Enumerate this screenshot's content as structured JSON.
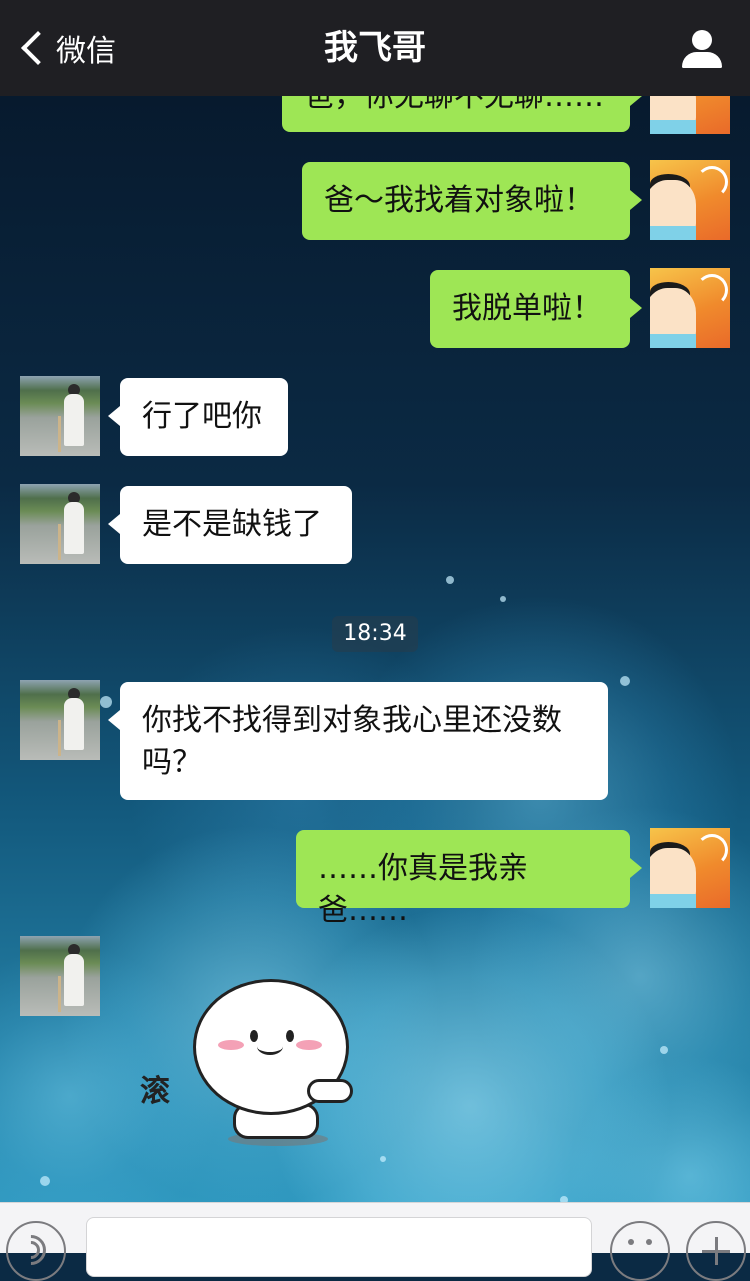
{
  "header": {
    "back_label": "微信",
    "title": "我飞哥"
  },
  "messages": [
    {
      "from": "me",
      "text": "爸，你无聊不无聊……"
    },
    {
      "from": "me",
      "text": "爸～我找着对象啦！"
    },
    {
      "from": "me",
      "text": "我脱单啦！"
    },
    {
      "from": "them",
      "text": "行了吧你"
    },
    {
      "from": "them",
      "text": "是不是缺钱了"
    },
    {
      "from": "them",
      "text": "你找不找得到对象我心里还没数吗？"
    },
    {
      "from": "me",
      "text": "……你真是我亲爸……"
    }
  ],
  "timestamp": "18:34",
  "sticker": {
    "text": "滚"
  },
  "colors": {
    "nav_bg": "#1f1f23",
    "my_bubble": "#9ee655",
    "their_bubble": "#ffffff"
  },
  "icons": [
    "back-chevron-icon",
    "profile-icon",
    "voice-icon",
    "emoji-icon",
    "plus-icon"
  ]
}
